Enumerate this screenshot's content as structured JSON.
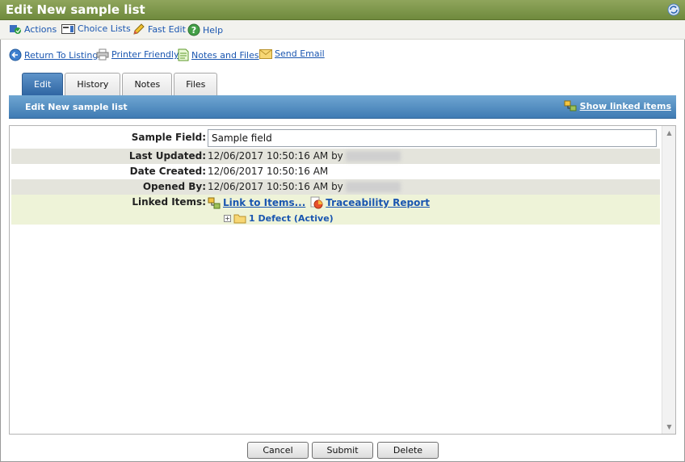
{
  "window": {
    "title": "Edit New sample list"
  },
  "menu": [
    {
      "label": "Actions"
    },
    {
      "label": "Choice Lists"
    },
    {
      "label": "Fast Edit"
    },
    {
      "label": "Help"
    }
  ],
  "links": [
    {
      "label": "Return To Listing"
    },
    {
      "label": "Printer Friendly"
    },
    {
      "label": "Notes and Files"
    },
    {
      "label": "Send Email"
    }
  ],
  "tabs": [
    {
      "label": "Edit",
      "active": true
    },
    {
      "label": "History"
    },
    {
      "label": "Notes"
    },
    {
      "label": "Files"
    }
  ],
  "section": {
    "title": "Edit New sample list",
    "show_linked_label": "Show linked items"
  },
  "form": {
    "sample_field": {
      "label": "Sample Field:",
      "value": "Sample field"
    },
    "last_updated": {
      "label": "Last Updated:",
      "value": "12/06/2017 10:50:16 AM by"
    },
    "date_created": {
      "label": "Date Created:",
      "value": "12/06/2017 10:50:16 AM"
    },
    "opened_by": {
      "label": "Opened By:",
      "value": "12/06/2017 10:50:16 AM by"
    },
    "linked_items": {
      "label": "Linked Items:",
      "link_to_items": "Link to Items...",
      "traceability": "Traceability Report",
      "tree_node": "1 Defect (Active)"
    }
  },
  "buttons": {
    "cancel": "Cancel",
    "submit": "Submit",
    "delete": "Delete"
  },
  "colors": {
    "title_bar": "#7a9447",
    "section_bar": "#4f89be",
    "active_tab": "#3a72ad",
    "link": "#1a56b0"
  }
}
